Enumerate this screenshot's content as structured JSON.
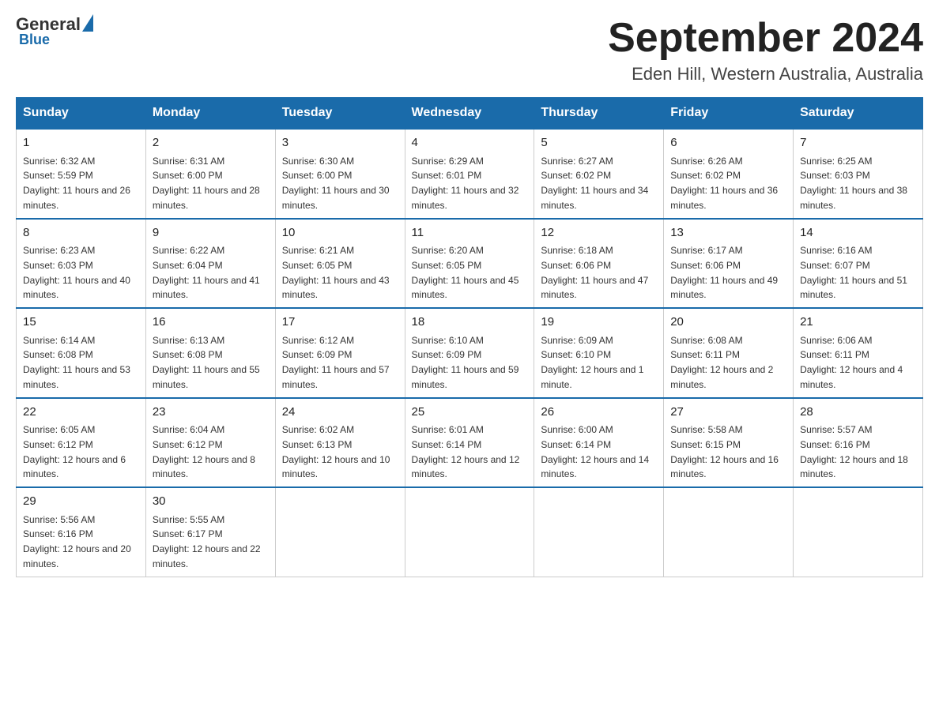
{
  "logo": {
    "general": "General",
    "blue": "Blue"
  },
  "title": "September 2024",
  "location": "Eden Hill, Western Australia, Australia",
  "days_of_week": [
    "Sunday",
    "Monday",
    "Tuesday",
    "Wednesday",
    "Thursday",
    "Friday",
    "Saturday"
  ],
  "weeks": [
    [
      {
        "day": "1",
        "sunrise": "6:32 AM",
        "sunset": "5:59 PM",
        "daylight": "11 hours and 26 minutes."
      },
      {
        "day": "2",
        "sunrise": "6:31 AM",
        "sunset": "6:00 PM",
        "daylight": "11 hours and 28 minutes."
      },
      {
        "day": "3",
        "sunrise": "6:30 AM",
        "sunset": "6:00 PM",
        "daylight": "11 hours and 30 minutes."
      },
      {
        "day": "4",
        "sunrise": "6:29 AM",
        "sunset": "6:01 PM",
        "daylight": "11 hours and 32 minutes."
      },
      {
        "day": "5",
        "sunrise": "6:27 AM",
        "sunset": "6:02 PM",
        "daylight": "11 hours and 34 minutes."
      },
      {
        "day": "6",
        "sunrise": "6:26 AM",
        "sunset": "6:02 PM",
        "daylight": "11 hours and 36 minutes."
      },
      {
        "day": "7",
        "sunrise": "6:25 AM",
        "sunset": "6:03 PM",
        "daylight": "11 hours and 38 minutes."
      }
    ],
    [
      {
        "day": "8",
        "sunrise": "6:23 AM",
        "sunset": "6:03 PM",
        "daylight": "11 hours and 40 minutes."
      },
      {
        "day": "9",
        "sunrise": "6:22 AM",
        "sunset": "6:04 PM",
        "daylight": "11 hours and 41 minutes."
      },
      {
        "day": "10",
        "sunrise": "6:21 AM",
        "sunset": "6:05 PM",
        "daylight": "11 hours and 43 minutes."
      },
      {
        "day": "11",
        "sunrise": "6:20 AM",
        "sunset": "6:05 PM",
        "daylight": "11 hours and 45 minutes."
      },
      {
        "day": "12",
        "sunrise": "6:18 AM",
        "sunset": "6:06 PM",
        "daylight": "11 hours and 47 minutes."
      },
      {
        "day": "13",
        "sunrise": "6:17 AM",
        "sunset": "6:06 PM",
        "daylight": "11 hours and 49 minutes."
      },
      {
        "day": "14",
        "sunrise": "6:16 AM",
        "sunset": "6:07 PM",
        "daylight": "11 hours and 51 minutes."
      }
    ],
    [
      {
        "day": "15",
        "sunrise": "6:14 AM",
        "sunset": "6:08 PM",
        "daylight": "11 hours and 53 minutes."
      },
      {
        "day": "16",
        "sunrise": "6:13 AM",
        "sunset": "6:08 PM",
        "daylight": "11 hours and 55 minutes."
      },
      {
        "day": "17",
        "sunrise": "6:12 AM",
        "sunset": "6:09 PM",
        "daylight": "11 hours and 57 minutes."
      },
      {
        "day": "18",
        "sunrise": "6:10 AM",
        "sunset": "6:09 PM",
        "daylight": "11 hours and 59 minutes."
      },
      {
        "day": "19",
        "sunrise": "6:09 AM",
        "sunset": "6:10 PM",
        "daylight": "12 hours and 1 minute."
      },
      {
        "day": "20",
        "sunrise": "6:08 AM",
        "sunset": "6:11 PM",
        "daylight": "12 hours and 2 minutes."
      },
      {
        "day": "21",
        "sunrise": "6:06 AM",
        "sunset": "6:11 PM",
        "daylight": "12 hours and 4 minutes."
      }
    ],
    [
      {
        "day": "22",
        "sunrise": "6:05 AM",
        "sunset": "6:12 PM",
        "daylight": "12 hours and 6 minutes."
      },
      {
        "day": "23",
        "sunrise": "6:04 AM",
        "sunset": "6:12 PM",
        "daylight": "12 hours and 8 minutes."
      },
      {
        "day": "24",
        "sunrise": "6:02 AM",
        "sunset": "6:13 PM",
        "daylight": "12 hours and 10 minutes."
      },
      {
        "day": "25",
        "sunrise": "6:01 AM",
        "sunset": "6:14 PM",
        "daylight": "12 hours and 12 minutes."
      },
      {
        "day": "26",
        "sunrise": "6:00 AM",
        "sunset": "6:14 PM",
        "daylight": "12 hours and 14 minutes."
      },
      {
        "day": "27",
        "sunrise": "5:58 AM",
        "sunset": "6:15 PM",
        "daylight": "12 hours and 16 minutes."
      },
      {
        "day": "28",
        "sunrise": "5:57 AM",
        "sunset": "6:16 PM",
        "daylight": "12 hours and 18 minutes."
      }
    ],
    [
      {
        "day": "29",
        "sunrise": "5:56 AM",
        "sunset": "6:16 PM",
        "daylight": "12 hours and 20 minutes."
      },
      {
        "day": "30",
        "sunrise": "5:55 AM",
        "sunset": "6:17 PM",
        "daylight": "12 hours and 22 minutes."
      },
      null,
      null,
      null,
      null,
      null
    ]
  ],
  "labels": {
    "sunrise": "Sunrise:",
    "sunset": "Sunset:",
    "daylight": "Daylight:"
  }
}
